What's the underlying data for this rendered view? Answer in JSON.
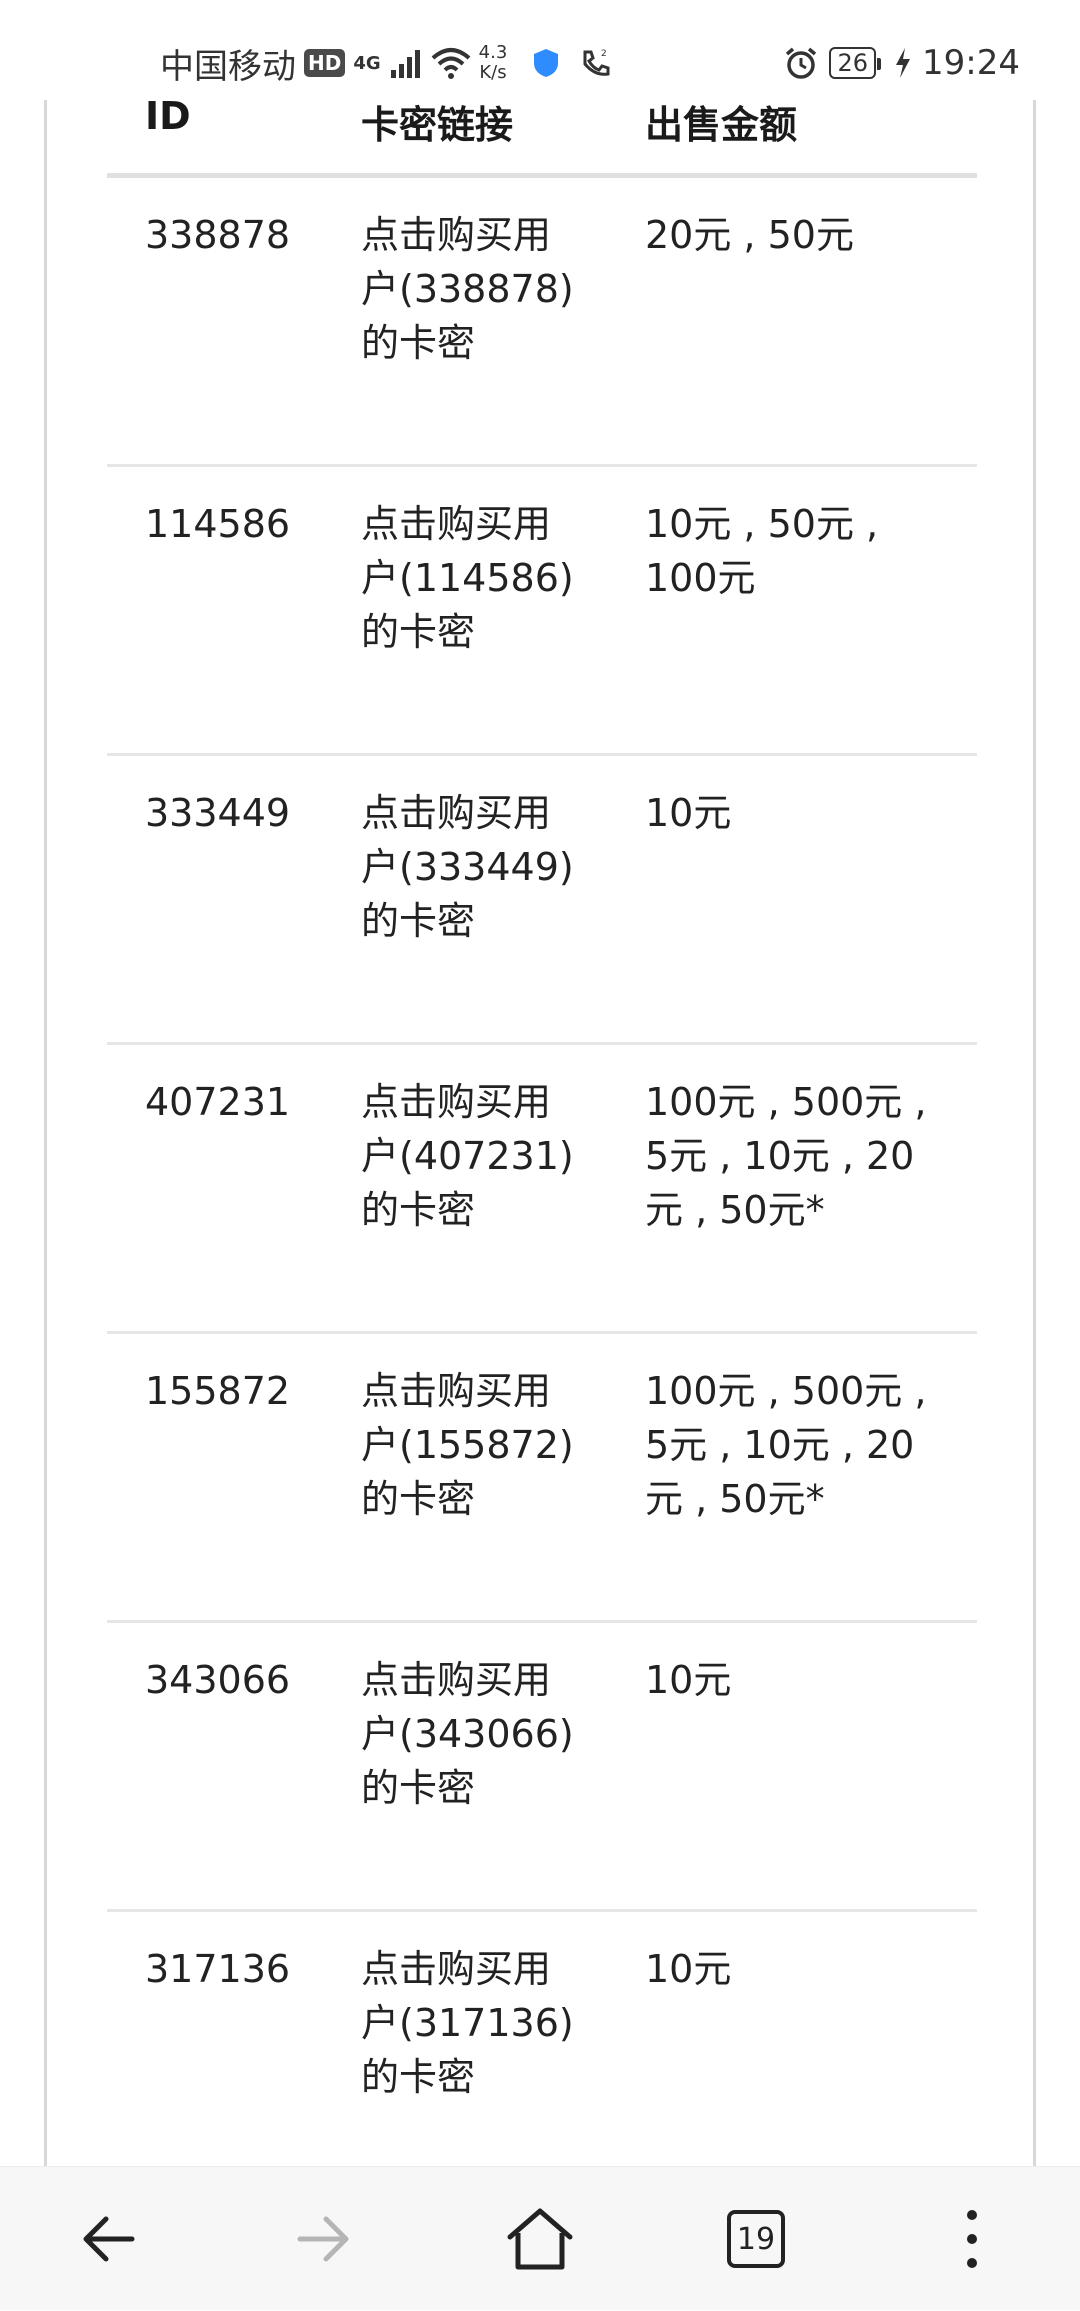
{
  "status_bar": {
    "carrier": "中国移动",
    "hd": "HD",
    "network": "4G",
    "speed_value": "4.3",
    "speed_unit": "K/s",
    "battery": "26",
    "time": "19:24"
  },
  "table": {
    "headers": {
      "id": "ID",
      "link": "卡密链接",
      "amount": "出售金额"
    },
    "rows": [
      {
        "id": "338878",
        "link": "点击购买用户(338878)的卡密",
        "amount": "20元 , 50元"
      },
      {
        "id": "114586",
        "link": "点击购买用户(114586)的卡密",
        "amount": "10元 , 50元 , 100元"
      },
      {
        "id": "333449",
        "link": "点击购买用户(333449)的卡密",
        "amount": "10元"
      },
      {
        "id": "407231",
        "link": "点击购买用户(407231)的卡密",
        "amount": "100元 , 500元 , 5元 , 10元 , 20元 , 50元*"
      },
      {
        "id": "155872",
        "link": "点击购买用户(155872)的卡密",
        "amount": "100元 , 500元 , 5元 , 10元 , 20元 , 50元*"
      },
      {
        "id": "343066",
        "link": "点击购买用户(343066)的卡密",
        "amount": "10元"
      },
      {
        "id": "317136",
        "link": "点击购买用户(317136)的卡密",
        "amount": "10元"
      }
    ]
  },
  "bottom_nav": {
    "tab_count": "19",
    "icons": [
      "back-arrow-icon",
      "forward-arrow-icon",
      "home-icon",
      "tabs-icon",
      "more-vertical-icon"
    ]
  },
  "colors": {
    "text": "#222222",
    "divider": "#e6e6e6",
    "disabled": "#b5b5b5",
    "nav_bg": "#f7f7f7",
    "shield": "#2f8cff"
  }
}
